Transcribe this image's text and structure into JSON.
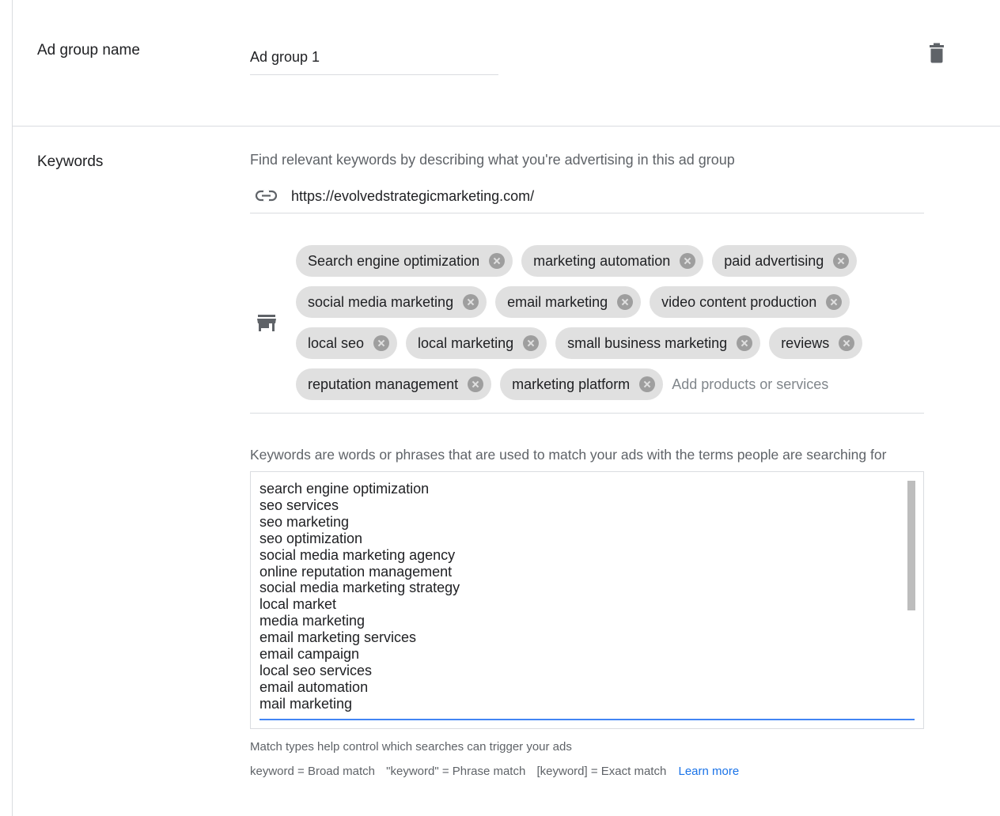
{
  "ad_group": {
    "label": "Ad group name",
    "name_value": "Ad group 1",
    "delete_icon": "trash-icon"
  },
  "keywords": {
    "label": "Keywords",
    "find_text": "Find relevant keywords by describing what you're advertising in this ad group",
    "url": {
      "icon": "link-icon",
      "value": "https://evolvedstrategicmarketing.com/"
    },
    "products": {
      "icon": "store-icon",
      "chips": [
        {
          "label": "Search engine optimization"
        },
        {
          "label": "marketing automation"
        },
        {
          "label": "paid advertising"
        },
        {
          "label": "social media marketing"
        },
        {
          "label": "email marketing"
        },
        {
          "label": "video content production"
        },
        {
          "label": "local seo"
        },
        {
          "label": "local marketing"
        },
        {
          "label": "small business marketing"
        },
        {
          "label": "reviews"
        },
        {
          "label": "reputation management"
        },
        {
          "label": "marketing platform"
        }
      ],
      "input_placeholder": "Add products or services"
    },
    "description": "Keywords are words or phrases that are used to match your ads with the terms people are searching for",
    "list": [
      "search engine optimization",
      "seo services",
      "seo marketing",
      "seo optimization",
      "social media marketing agency",
      "online reputation management",
      "social media marketing strategy",
      "local market",
      "media marketing",
      "email marketing services",
      "email campaign",
      "local seo services",
      "email automation",
      "mail marketing"
    ]
  },
  "match_types": {
    "help": "Match types help control which searches can trigger your ads",
    "broad": "keyword = Broad match",
    "phrase": "\"keyword\" = Phrase match",
    "exact": "[keyword] = Exact match",
    "learn_more": "Learn more"
  },
  "colors": {
    "accent": "#4285f4",
    "link": "#1a73e8",
    "chip_bg": "#e0e0e0",
    "divider": "#dadce0"
  }
}
